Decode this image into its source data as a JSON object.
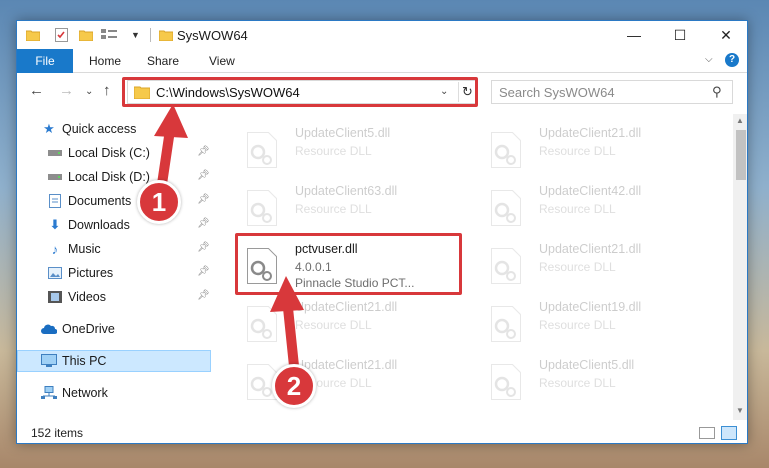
{
  "window": {
    "title": "SysWOW64",
    "controls": {
      "minimize": "—",
      "maximize": "☐",
      "close": "✕"
    }
  },
  "ribbon": {
    "tabs": [
      "File",
      "Home",
      "Share",
      "View"
    ]
  },
  "navigation": {
    "address": "C:\\Windows\\SysWOW64",
    "search_placeholder": "Search SysWOW64"
  },
  "sidebar": {
    "items": [
      {
        "label": "Quick access",
        "icon": "star-icon",
        "pinned": false
      },
      {
        "label": "Local Disk (C:)",
        "icon": "drive-icon",
        "pinned": true
      },
      {
        "label": "Local Disk (D:)",
        "icon": "drive-icon",
        "pinned": true
      },
      {
        "label": "Documents",
        "icon": "document-icon",
        "pinned": true
      },
      {
        "label": "Downloads",
        "icon": "download-icon",
        "pinned": true
      },
      {
        "label": "Music",
        "icon": "music-icon",
        "pinned": true
      },
      {
        "label": "Pictures",
        "icon": "picture-icon",
        "pinned": true
      },
      {
        "label": "Videos",
        "icon": "video-icon",
        "pinned": true
      },
      {
        "label": "OneDrive",
        "icon": "cloud-icon",
        "pinned": false
      },
      {
        "label": "This PC",
        "icon": "computer-icon",
        "pinned": false,
        "selected": true
      },
      {
        "label": "Network",
        "icon": "network-icon",
        "pinned": false
      }
    ]
  },
  "files": [
    {
      "name": "UpdateClient5.dll",
      "line1": "Resource DLL",
      "line2": "",
      "faded": true
    },
    {
      "name": "UpdateClient21.dll",
      "line1": "Resource DLL",
      "line2": "",
      "faded": true
    },
    {
      "name": "UpdateClient63.dll",
      "line1": "Resource DLL",
      "line2": "",
      "faded": true
    },
    {
      "name": "UpdateClient42.dll",
      "line1": "Resource DLL",
      "line2": "",
      "faded": true
    },
    {
      "name": "pctvuser.dll",
      "line1": "4.0.0.1",
      "line2": "Pinnacle Studio PCT...",
      "faded": false
    },
    {
      "name": "UpdateClient21.dll",
      "line1": "Resource DLL",
      "line2": "",
      "faded": true
    },
    {
      "name": "UpdateClient21.dll",
      "line1": "Resource DLL",
      "line2": "",
      "faded": true
    },
    {
      "name": "UpdateClient19.dll",
      "line1": "Resource DLL",
      "line2": "",
      "faded": true
    },
    {
      "name": "UpdateClient21.dll",
      "line1": "Resource DLL",
      "line2": "",
      "faded": true
    },
    {
      "name": "UpdateClient5.dll",
      "line1": "Resource DLL",
      "line2": "",
      "faded": true
    }
  ],
  "status": {
    "item_count": "152 items"
  },
  "annotations": {
    "step1": "1",
    "step2": "2",
    "color": "#d8383b"
  }
}
